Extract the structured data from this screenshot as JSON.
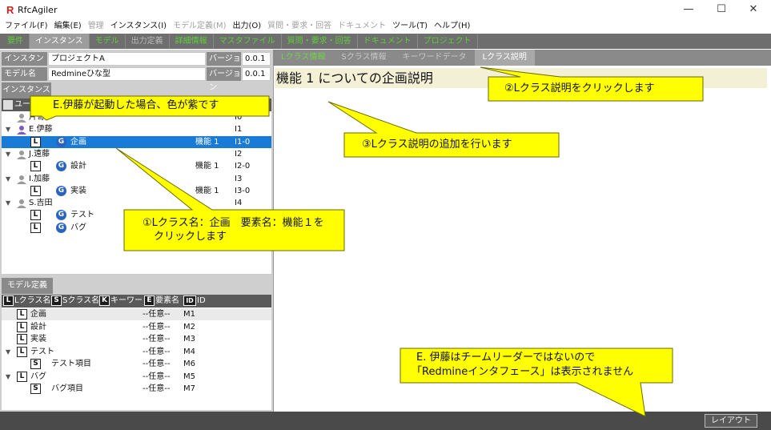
{
  "window": {
    "logo": "R",
    "title": "RfcAgiler",
    "minimize": "—",
    "maximize": "☐",
    "close": "✕"
  },
  "menu": [
    {
      "label": "ファイル(F)",
      "dim": false
    },
    {
      "label": "編集(E)",
      "dim": false
    },
    {
      "label": "管理",
      "dim": true
    },
    {
      "label": "インスタンス(I)",
      "dim": false
    },
    {
      "label": "モデル定義(M)",
      "dim": true
    },
    {
      "label": "出力(O)",
      "dim": false
    },
    {
      "label": "質問・要求・回答",
      "dim": true
    },
    {
      "label": "ドキュメント",
      "dim": true
    },
    {
      "label": "ツール(T)",
      "dim": false
    },
    {
      "label": "ヘルプ(H)",
      "dim": false
    }
  ],
  "tabs": [
    "要件",
    "インスタンス",
    "モデル",
    "出力定義",
    "詳細情報",
    "マスタファイル",
    "質問・要求・回答",
    "ドキュメント",
    "プロジェクト"
  ],
  "instance": {
    "name_label": "インスタンス名",
    "name_value": "プロジェクトA",
    "version_label": "バージョン",
    "version_value": "0.0.1",
    "model_label": "モデル名",
    "model_value": "Redmineひな型",
    "model_version_label": "バージョン",
    "model_version_value": "0.0.1"
  },
  "instance_tab": "インスタンス",
  "user_tree": {
    "header_user": "ユーザ名",
    "rows": [
      {
        "type": "user",
        "name": "片寄",
        "id": "I0",
        "color": "#9a9a9a",
        "expander": false
      },
      {
        "type": "user",
        "name": "E.伊藤",
        "id": "I1",
        "color": "#7a5cc0",
        "expander": true
      },
      {
        "type": "item",
        "name": "企画",
        "element": "機能 1",
        "id": "I1-0",
        "selected": true
      },
      {
        "type": "user",
        "name": "J.遠藤",
        "id": "I2",
        "color": "#9a9a9a",
        "expander": true
      },
      {
        "type": "item",
        "name": "設計",
        "element": "機能 1",
        "id": "I2-0",
        "selected": false
      },
      {
        "type": "user",
        "name": "I.加藤",
        "id": "I3",
        "color": "#9a9a9a",
        "expander": true
      },
      {
        "type": "item",
        "name": "実装",
        "element": "機能 1",
        "id": "I3-0",
        "selected": false
      },
      {
        "type": "user",
        "name": "S.吉田",
        "id": "I4",
        "color": "#9a9a9a",
        "expander": true
      },
      {
        "type": "item",
        "name": "テスト",
        "element": "",
        "id": "",
        "selected": false
      },
      {
        "type": "item",
        "name": "バグ",
        "element": "",
        "id": "",
        "selected": false
      }
    ],
    "ltag": "L",
    "gtag": "G"
  },
  "model_def": {
    "tab": "モデル定義",
    "headers": [
      {
        "tag": "L",
        "label": "Lクラス名"
      },
      {
        "tag": "S",
        "label": "Sクラス名"
      },
      {
        "tag": "K",
        "label": "キーワード"
      },
      {
        "tag": "E",
        "label": "要素名"
      },
      {
        "tag": "ID",
        "label": "ID"
      }
    ],
    "rows": [
      {
        "tag": "L",
        "name": "企画",
        "elem": "--任意--",
        "id": "M1",
        "level": 0,
        "expander": false,
        "highlight": true
      },
      {
        "tag": "L",
        "name": "設計",
        "elem": "--任意--",
        "id": "M2",
        "level": 0,
        "expander": false,
        "highlight": false
      },
      {
        "tag": "L",
        "name": "実装",
        "elem": "--任意--",
        "id": "M3",
        "level": 0,
        "expander": false,
        "highlight": false
      },
      {
        "tag": "L",
        "name": "テスト",
        "elem": "--任意--",
        "id": "M4",
        "level": 0,
        "expander": true,
        "highlight": false
      },
      {
        "tag": "S",
        "name": "テスト項目",
        "elem": "--任意--",
        "id": "M6",
        "level": 1,
        "expander": false,
        "highlight": false
      },
      {
        "tag": "L",
        "name": "バグ",
        "elem": "--任意--",
        "id": "M5",
        "level": 0,
        "expander": true,
        "highlight": false
      },
      {
        "tag": "S",
        "name": "バグ項目",
        "elem": "--任意--",
        "id": "M7",
        "level": 1,
        "expander": false,
        "highlight": false
      }
    ]
  },
  "right_tabs": [
    {
      "label": "Lクラス情報",
      "style": "green"
    },
    {
      "label": "Sクラス情報",
      "style": "gray"
    },
    {
      "label": "キーワードデータ",
      "style": "gray"
    },
    {
      "label": "Lクラス説明",
      "style": "active"
    }
  ],
  "description": "機能 1 についての企画説明",
  "layout_button": "レイアウト",
  "callouts": {
    "c_e": "E.伊藤が起動した場合、色が紫です",
    "c1_line1": "①Lクラス名：企画　要素名：機能１を",
    "c1_line2": "クリックします",
    "c2": "②Lクラス説明をクリックします",
    "c3": "③Lクラス説明の追加を行います",
    "c4_line1": "E. 伊藤はチームリーダーではないので",
    "c4_line2": "「Redmineインタフェース」は表示されません"
  },
  "colors": {
    "callout_fill": "#ffff00",
    "callout_stroke": "#6a6a00",
    "selection": "#1a7bd6",
    "tab_green": "#5fcf3a"
  }
}
